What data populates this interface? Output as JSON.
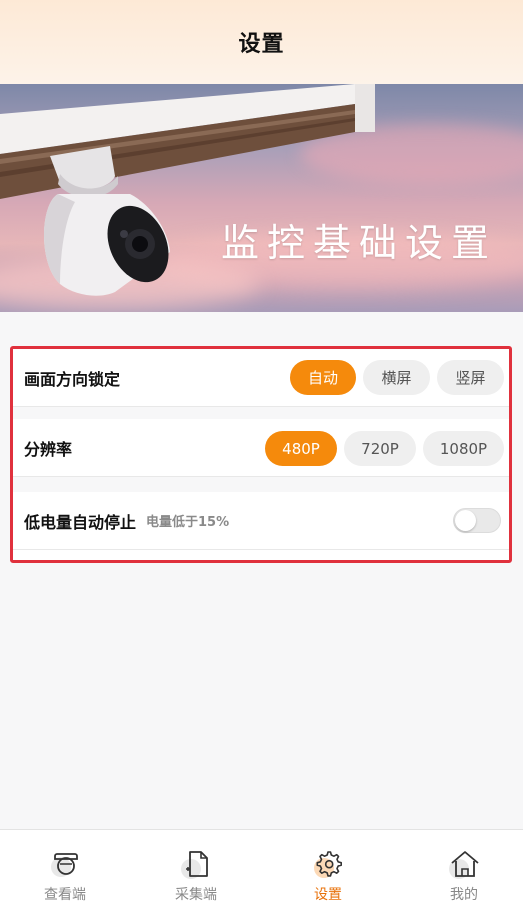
{
  "header": {
    "title": "设置"
  },
  "banner": {
    "text": "监控基础设置"
  },
  "settings": {
    "orientation": {
      "label": "画面方向锁定",
      "options": [
        "自动",
        "横屏",
        "竖屏"
      ],
      "selected": "自动"
    },
    "resolution": {
      "label": "分辨率",
      "options": [
        "480P",
        "720P",
        "1080P"
      ],
      "selected": "480P"
    },
    "low_battery": {
      "label": "低电量自动停止",
      "note": "电量低于15%",
      "enabled": false
    }
  },
  "tabbar": {
    "items": [
      {
        "label": "查看端",
        "icon": "camera-view-icon"
      },
      {
        "label": "采集端",
        "icon": "capture-file-icon"
      },
      {
        "label": "设置",
        "icon": "gear-icon",
        "active": true
      },
      {
        "label": "我的",
        "icon": "home-icon"
      }
    ]
  },
  "colors": {
    "accent": "#f58a0c",
    "highlight_border": "#e0313d",
    "active_tab": "#e8710a"
  }
}
